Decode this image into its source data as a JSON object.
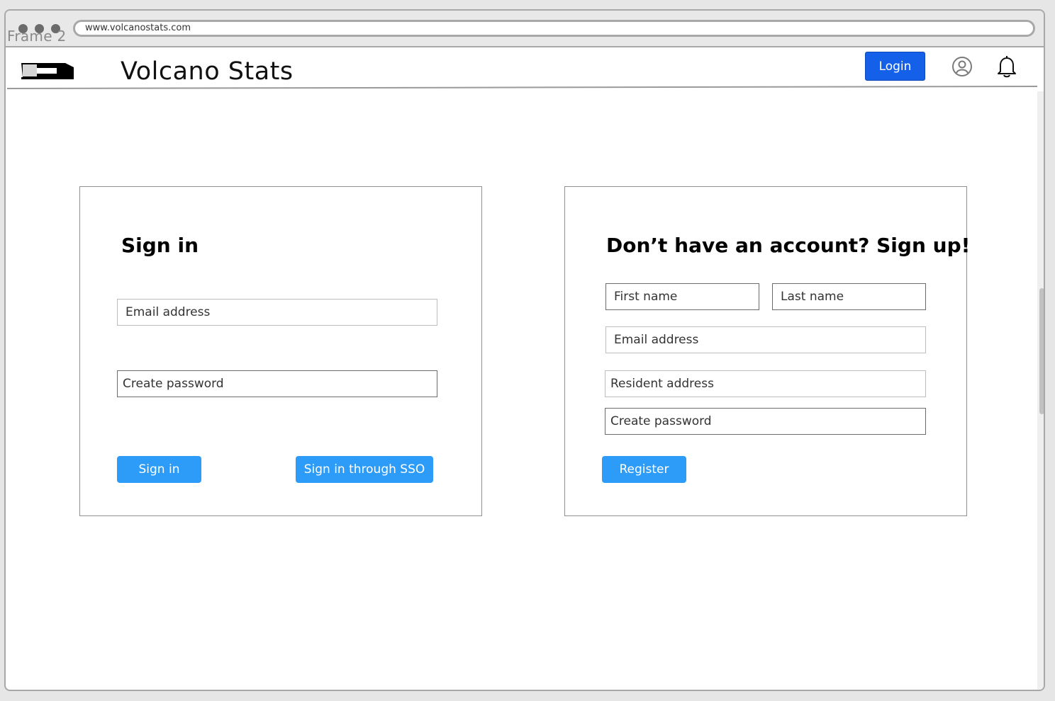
{
  "frame_label": "Frame 2",
  "browser": {
    "url": "www.volcanostats.com"
  },
  "header": {
    "brand": "Volcano Stats",
    "login_label": "Login",
    "icons": [
      "logo",
      "user-icon",
      "bell-icon"
    ]
  },
  "signin": {
    "title": "Sign in",
    "email_placeholder": "Email address",
    "password_placeholder": "Create password",
    "signin_label": "Sign in",
    "sso_label": "Sign in through SSO"
  },
  "signup": {
    "title": "Don’t have an account? Sign up!",
    "first_name_placeholder": "First name",
    "last_name_placeholder": "Last name",
    "email_placeholder": "Email address",
    "address_placeholder": "Resident address",
    "password_placeholder": "Create password",
    "register_label": "Register"
  },
  "colors": {
    "login_button": "#1560e8",
    "action_button": "#2d9cf9"
  }
}
